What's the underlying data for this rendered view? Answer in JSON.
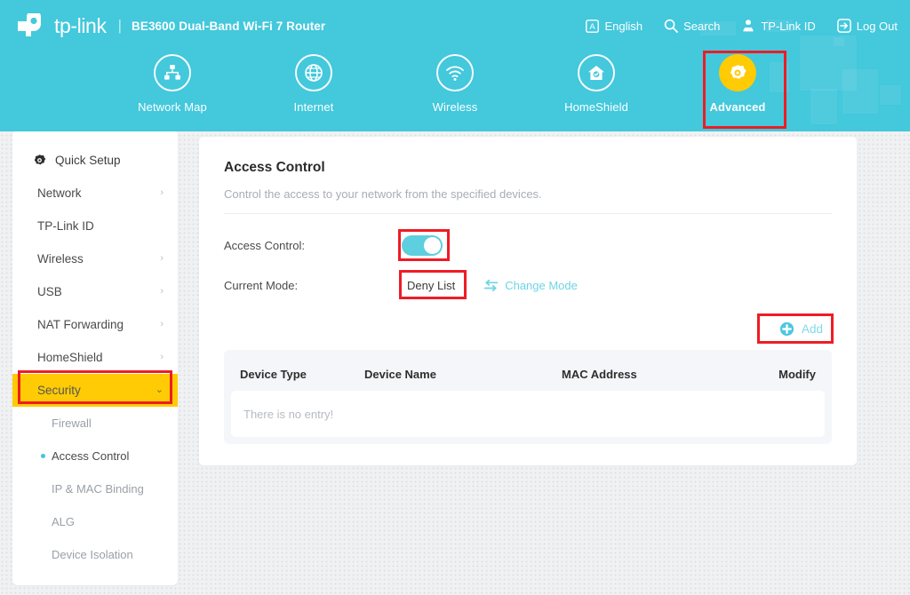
{
  "header": {
    "brand": "tp-link",
    "brand_icon": "tplink-logo-icon",
    "divider": "|",
    "model": "BE3600 Dual-Band Wi-Fi 7 Router",
    "actions": [
      {
        "label": "English",
        "icon": "language-icon"
      },
      {
        "label": "Search",
        "icon": "search-icon"
      },
      {
        "label": "TP-Link ID",
        "icon": "tplink-id-icon"
      },
      {
        "label": "Log Out",
        "icon": "logout-icon"
      }
    ]
  },
  "tabs": [
    {
      "label": "Network Map",
      "icon": "network-map-icon",
      "active": false
    },
    {
      "label": "Internet",
      "icon": "globe-icon",
      "active": false
    },
    {
      "label": "Wireless",
      "icon": "wifi-icon",
      "active": false
    },
    {
      "label": "HomeShield",
      "icon": "home-shield-icon",
      "active": false
    },
    {
      "label": "Advanced",
      "icon": "gear-icon",
      "active": true
    }
  ],
  "sidebar": {
    "quick_setup": {
      "label": "Quick Setup",
      "icon": "gear-icon"
    },
    "items": [
      {
        "label": "Network",
        "chevron": "›",
        "selected": false
      },
      {
        "label": "TP-Link ID",
        "chevron": "",
        "selected": false
      },
      {
        "label": "Wireless",
        "chevron": "›",
        "selected": false
      },
      {
        "label": "USB",
        "chevron": "›",
        "selected": false
      },
      {
        "label": "NAT Forwarding",
        "chevron": "›",
        "selected": false
      },
      {
        "label": "HomeShield",
        "chevron": "›",
        "selected": false
      },
      {
        "label": "Security",
        "chevron": "⌄",
        "selected": true
      }
    ],
    "sub_items": [
      {
        "label": "Firewall",
        "active": false
      },
      {
        "label": "Access Control",
        "active": true
      },
      {
        "label": "IP & MAC Binding",
        "active": false
      },
      {
        "label": "ALG",
        "active": false
      },
      {
        "label": "Device Isolation",
        "active": false
      }
    ]
  },
  "main": {
    "title": "Access Control",
    "subtitle": "Control the access to your network from the specified devices.",
    "access_control_label": "Access Control:",
    "access_control_enabled": true,
    "current_mode_label": "Current Mode:",
    "current_mode_value": "Deny List",
    "change_mode_label": "Change Mode",
    "change_mode_icon": "swap-arrows-icon",
    "add_label": "Add",
    "add_icon": "plus-circle-icon",
    "table": {
      "columns": [
        "Device Type",
        "Device Name",
        "MAC Address",
        "Modify"
      ],
      "rows": [],
      "empty_text": "There is no entry!"
    }
  },
  "colors": {
    "header_teal": "#43c8dc",
    "accent_yellow": "#ffcb05",
    "annotation_red": "#ee1c25",
    "link_teal": "#6fd4e4",
    "toggle_on": "#5ecfdf"
  }
}
